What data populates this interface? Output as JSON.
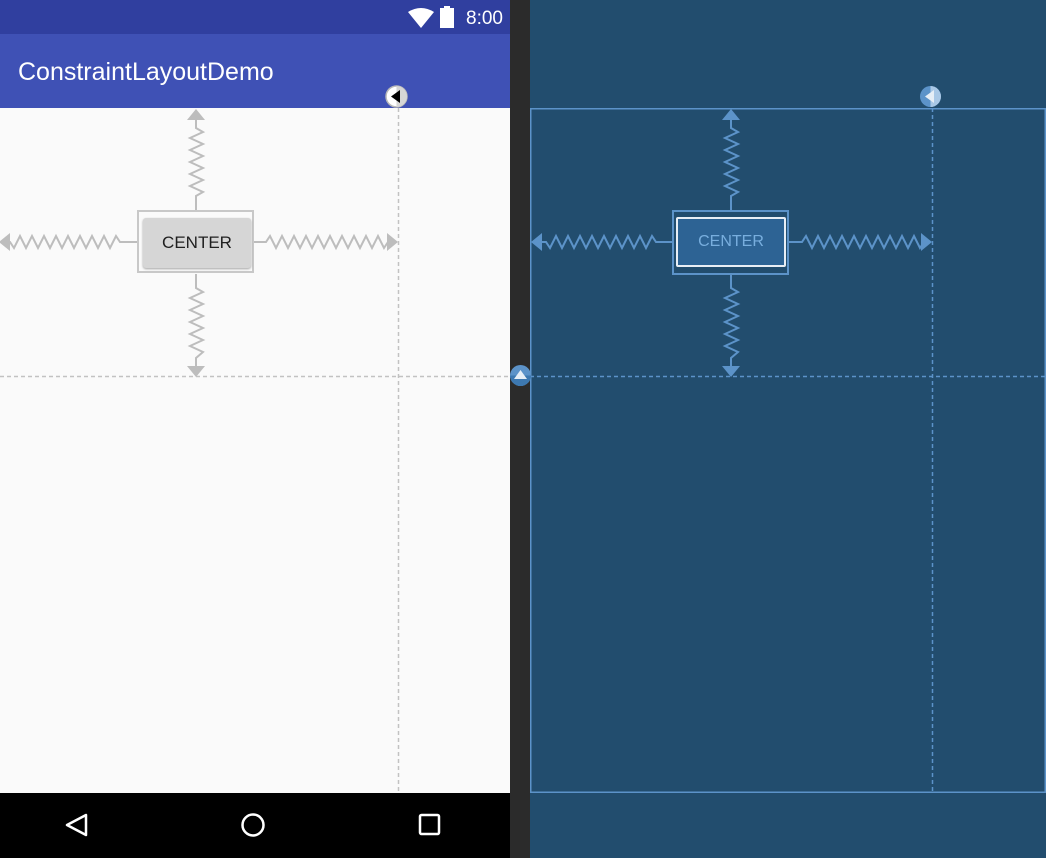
{
  "status_bar": {
    "time": "8:00",
    "icons": [
      "wifi-icon",
      "battery-icon"
    ]
  },
  "app_bar": {
    "title": "ConstraintLayoutDemo"
  },
  "design_view": {
    "button_label": "CENTER"
  },
  "blueprint_view": {
    "button_label": "CENTER"
  },
  "nav_bar": {
    "buttons": [
      "back-icon",
      "home-icon",
      "recents-icon"
    ]
  },
  "colors": {
    "status_bar": "#303f9f",
    "app_bar": "#3f51b5",
    "blueprint_bg": "#224d6e",
    "blueprint_line": "#5c93c9",
    "constraint_gray": "#bdbdbd"
  }
}
